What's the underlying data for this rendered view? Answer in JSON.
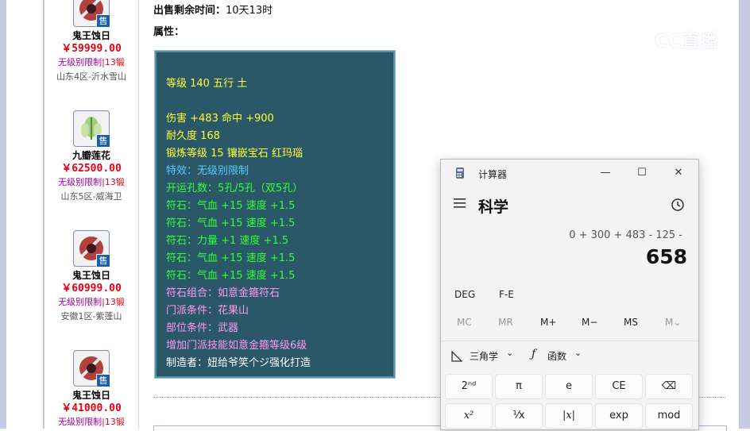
{
  "items": [
    {
      "name": "鬼王蚀日",
      "price": "￥59999.00",
      "limit": "无级别限制",
      "forge": "|13锻",
      "server": "山东4区-沂水雪山",
      "badge": "售",
      "icon": "ghost-king-weapon-icon"
    },
    {
      "name": "九瓣莲花",
      "price": "￥62500.00",
      "limit": "无级别限制",
      "forge": "|13锻",
      "server": "山东5区-威海卫",
      "badge": "售",
      "icon": "lotus-icon"
    },
    {
      "name": "鬼王蚀日",
      "price": "￥60999.00",
      "limit": "无级别限制",
      "forge": "|13锻",
      "server": "安徽1区-紫蓬山",
      "badge": "售",
      "icon": "ghost-king-weapon-icon"
    },
    {
      "name": "鬼王蚀日",
      "price": "￥41000.00",
      "limit": "无级别限制",
      "forge": "|13锻",
      "server": "",
      "badge": "售",
      "icon": "ghost-king-weapon-icon"
    }
  ],
  "detail": {
    "time_label": "出售剩余时间：",
    "time_value": "10天13时",
    "attr_label": "属性："
  },
  "properties": [
    {
      "text": "等级 140 五行 土",
      "color": "#ffff33"
    },
    {
      "text": "伤害 +483 命中 +900",
      "color": "#ffff33"
    },
    {
      "text": "耐久度 168",
      "color": "#ffff33"
    },
    {
      "text": "锻炼等级 15 镶嵌宝石 红玛瑙",
      "color": "#ffff33"
    },
    {
      "text": "特效：无级别限制",
      "color": "#5ec8ff"
    },
    {
      "text": "开运孔数：5孔/5孔（双5孔）",
      "color": "#33ff33"
    },
    {
      "text": "符石：气血 +15 速度 +1.5",
      "color": "#33ff33"
    },
    {
      "text": "符石：气血 +15 速度 +1.5",
      "color": "#33ff33"
    },
    {
      "text": "符石：力量 +1 速度 +1.5",
      "color": "#33ff33"
    },
    {
      "text": "符石：气血 +15 速度 +1.5",
      "color": "#33ff33"
    },
    {
      "text": "符石：气血 +15 速度 +1.5",
      "color": "#33ff33"
    },
    {
      "text": "符石组合：如意金箍符石",
      "color": "#ff99ee"
    },
    {
      "text": "门派条件：花果山",
      "color": "#ff99ee"
    },
    {
      "text": "部位条件：武器",
      "color": "#ff99ee"
    },
    {
      "text": "增加门派技能如意金箍等级6级",
      "color": "#ff99ee"
    },
    {
      "text": "制造者：妞给爷笑个ジ强化打造",
      "color": "#ffffff"
    }
  ],
  "watermark": "CC直播",
  "calculator": {
    "title": "计算器",
    "mode": "科学",
    "expression": "0 + 300 + 483 - 125 -",
    "result": "658",
    "angle": "DEG",
    "fe": "F-E",
    "memory": [
      "MC",
      "MR",
      "M+",
      "M−",
      "MS",
      "M⌄"
    ],
    "trig": "三角学",
    "func": "函数",
    "keys_row1": [
      "2ⁿᵈ",
      "π",
      "e",
      "CE",
      "⌫"
    ],
    "keys_row2": [
      "x²",
      "¹⁄x",
      "|x|",
      "exp",
      "mod"
    ]
  }
}
